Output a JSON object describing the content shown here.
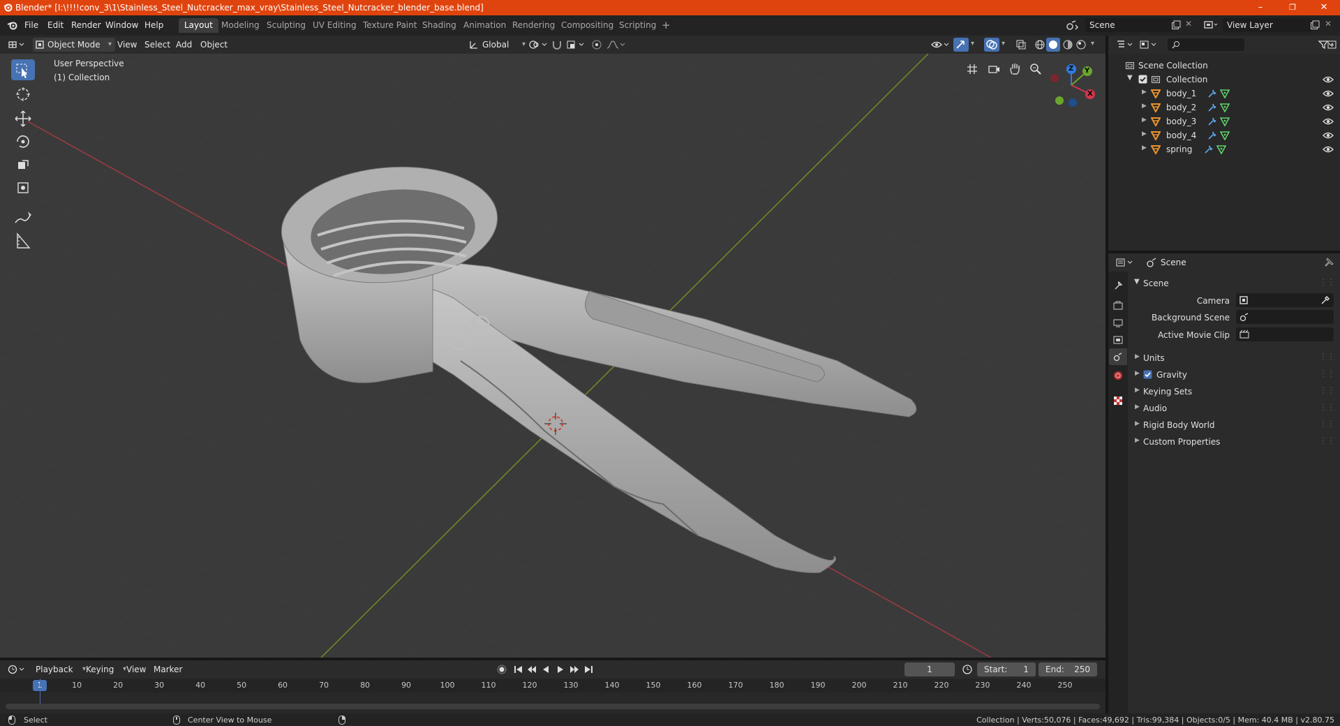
{
  "window": {
    "title": "Blender* [I:\\!!!!conv_3\\1\\Stainless_Steel_Nutcracker_max_vray\\Stainless_Steel_Nutcracker_blender_base.blend]",
    "minimize": "–",
    "maximize": "❐",
    "close": "✕"
  },
  "menubar": {
    "items": [
      "File",
      "Edit",
      "Render",
      "Window",
      "Help"
    ]
  },
  "workspaces": [
    "Layout",
    "Modeling",
    "Sculpting",
    "UV Editing",
    "Texture Paint",
    "Shading",
    "Animation",
    "Rendering",
    "Compositing",
    "Scripting"
  ],
  "workspace_add": "+",
  "scene_field": "Scene",
  "view_layer_field": "View Layer",
  "viewport_header": {
    "mode": "Object Mode",
    "menus": [
      "View",
      "Select",
      "Add",
      "Object"
    ],
    "transform_orientation": "Global"
  },
  "viewport": {
    "perspective_label": "User Perspective",
    "collection_label": "(1) Collection",
    "gizmo": {
      "x": "X",
      "y": "Y",
      "z": "Z"
    }
  },
  "outliner": {
    "root": "Scene Collection",
    "collection": "Collection",
    "objects": [
      "body_1",
      "body_2",
      "body_3",
      "body_4",
      "spring"
    ]
  },
  "properties": {
    "header_title": "Scene",
    "panel_title": "Scene",
    "camera_label": "Camera",
    "background_scene_label": "Background Scene",
    "active_movie_clip_label": "Active Movie Clip",
    "sections": [
      "Units",
      "Gravity",
      "Keying Sets",
      "Audio",
      "Rigid Body World",
      "Custom Properties"
    ],
    "gravity_checked": true
  },
  "timeline": {
    "menus": [
      "Playback",
      "Keying",
      "View",
      "Marker"
    ],
    "current_frame": "1",
    "start_label": "Start:",
    "start_value": "1",
    "end_label": "End:",
    "end_value": "250",
    "ruler": [
      "1",
      "10",
      "20",
      "30",
      "40",
      "50",
      "60",
      "70",
      "80",
      "90",
      "100",
      "110",
      "120",
      "130",
      "140",
      "150",
      "160",
      "170",
      "180",
      "190",
      "200",
      "210",
      "220",
      "230",
      "240",
      "250"
    ]
  },
  "statusbar": {
    "select": "Select",
    "center_view": "Center View to Mouse",
    "stats": "Collection | Verts:50,076 | Faces:49,692 | Tris:99,384 | Objects:0/5 | Mem: 40.4 MB | v2.80.75"
  },
  "colors": {
    "titlebar": "#e0440e",
    "accent": "#4772b3",
    "object_orange": "#e8932f",
    "modifier_blue": "#5fa8e8",
    "mesh_green": "#5fd36a",
    "axis_red": "#c23b4a",
    "axis_green": "#6f9a24"
  }
}
